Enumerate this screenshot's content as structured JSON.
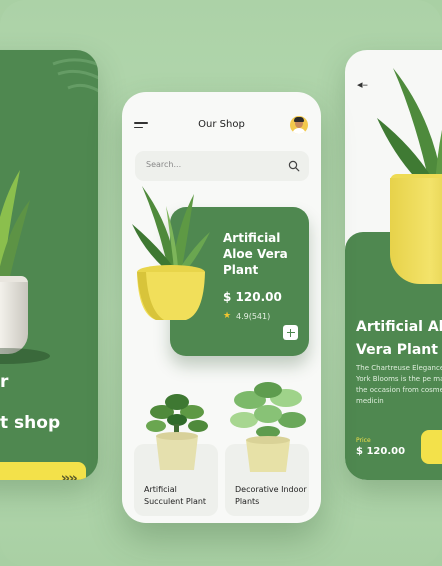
{
  "left_screen": {
    "heading_line1": "r",
    "heading_line2": "t shop",
    "cta_arrows": "»»"
  },
  "shop": {
    "title": "Our Shop",
    "search": {
      "placeholder": "Search..."
    },
    "featured": {
      "name": "Artificial Aloe Vera Plant",
      "price": "$ 120.00",
      "rating": "4.9(541)"
    },
    "products": [
      {
        "name": "Artificial Succulent Plant"
      },
      {
        "name": "Decorative Indoor Plants"
      }
    ]
  },
  "detail_screen": {
    "title": "Artificial Aloe Vera Plant",
    "description": "The Chartreuse Elegance by New York Blooms is the pe matter what the occasion from cosmetic to medicin",
    "price_label": "Price",
    "price": "$ 120.00"
  },
  "colors": {
    "brand_green": "#4f8850",
    "accent_yellow": "#f3e14a",
    "background": "#b2d6ad"
  }
}
